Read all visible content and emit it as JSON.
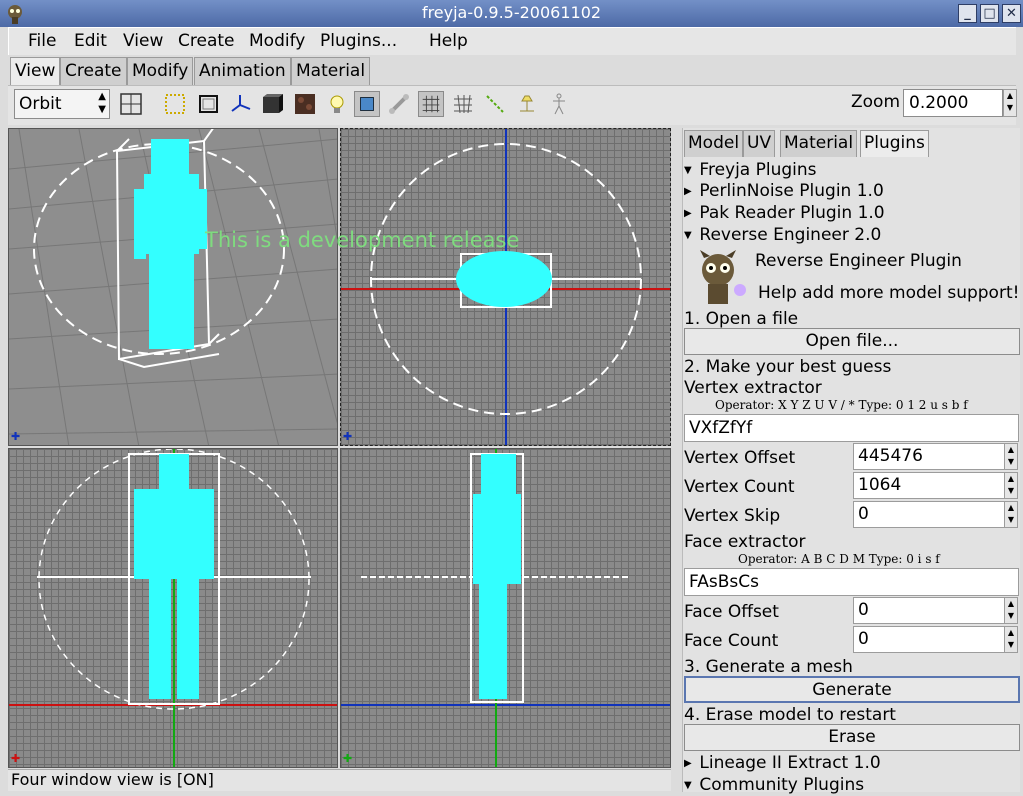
{
  "window": {
    "title": "freyja-0.9.5-20061102",
    "minimize_glyph": "_",
    "maximize_glyph": "□",
    "close_glyph": "✕"
  },
  "menu": {
    "file": "File",
    "edit": "Edit",
    "view": "View",
    "create": "Create",
    "modify": "Modify",
    "plugins": "Plugins...",
    "help": "Help"
  },
  "tabs": {
    "view": "View",
    "create": "Create",
    "modify": "Modify",
    "animation": "Animation",
    "material": "Material"
  },
  "toolbar": {
    "mode": "Orbit",
    "zoom_label": "Zoom",
    "zoom_value": "0.2000",
    "icons": [
      "four-window-icon",
      "select-vertex-icon",
      "bounding-box-icon",
      "axis-icon",
      "solid-cube-icon",
      "texture-icon",
      "light-bulb-icon",
      "object-select-icon",
      "bone-icon",
      "wireframe-mesh-icon",
      "grid-mesh-icon",
      "line-icon",
      "lamp-icon",
      "skeleton-icon"
    ]
  },
  "viewport": {
    "watermark": "This is a development release"
  },
  "status": {
    "text": "Four window view is [ON]"
  },
  "panel": {
    "tabs": {
      "model": "Model",
      "uv": "UV",
      "material": "Material",
      "plugins": "Plugins"
    },
    "freyja_plugins": "Freyja Plugins",
    "perlin": "PerlinNoise Plugin 1.0",
    "pak": "Pak Reader Plugin 1.0",
    "reverse": "Reverse Engineer 2.0",
    "reverse_title": "Reverse Engineer Plugin",
    "reverse_subtitle": "Help add more model support!",
    "step1": "1. Open a file",
    "open_file": "Open file...",
    "step2": "2. Make your best guess",
    "vertex_extractor": "Vertex extractor",
    "vertex_operator": "Operator: X Y Z U V / *   Type: 0 1 2 u s b f",
    "vertex_pattern": "VXfZfYf",
    "vertex_offset_label": "Vertex Offset",
    "vertex_offset": "445476",
    "vertex_count_label": "Vertex Count",
    "vertex_count": "1064",
    "vertex_skip_label": "Vertex Skip",
    "vertex_skip": "0",
    "face_extractor": "Face extractor",
    "face_operator": "Operator: A B C D M     Type: 0 i s f",
    "face_pattern": "FAsBsCs",
    "face_offset_label": "Face Offset",
    "face_offset": "0",
    "face_count_label": "Face Count",
    "face_count": "0",
    "step3": "3. Generate a mesh",
    "generate": "Generate",
    "step4": "4. Erase model to restart",
    "erase": "Erase",
    "lineage": "Lineage II Extract 1.0",
    "community": "Community Plugins"
  },
  "colors": {
    "mesh": "#33ffff",
    "titlebar": "#5a76b0",
    "axis_red": "#cc1111",
    "axis_blue": "#1133bb",
    "axis_green": "#11aa11"
  }
}
